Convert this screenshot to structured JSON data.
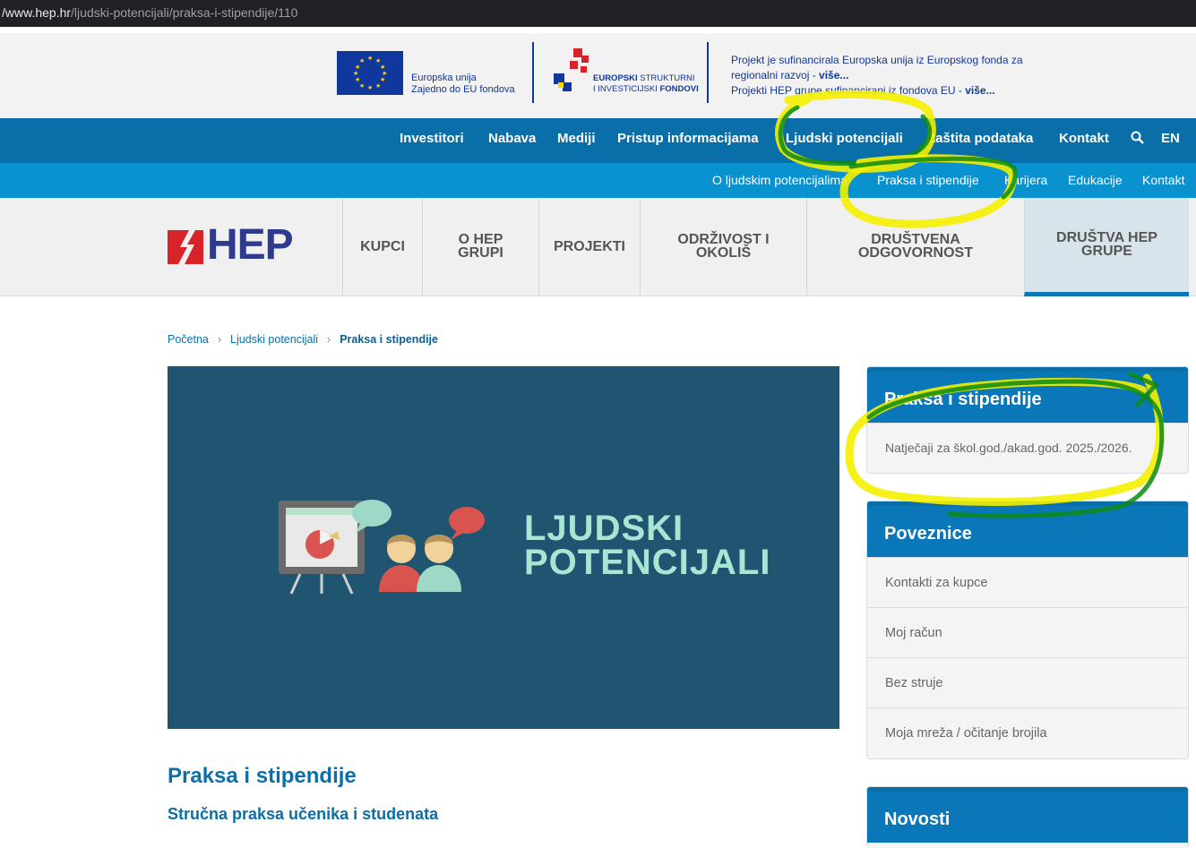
{
  "browser": {
    "url_host": "/www.hep.hr",
    "url_path": "/ljudski-potencijali/praksa-i-stipendije/110"
  },
  "eu_banner": {
    "eu_line1": "Europska unija",
    "eu_line2": "Zajedno do EU fondova",
    "esif_line1_bold": "EUROPSKI",
    "esif_line1_rest": " STRUKTURNI",
    "esif_line2_rest": "I INVESTICIJSKI ",
    "esif_line2_bold": "FONDOVI",
    "note1": "Projekt je sufinancirala Europska unija iz Europskog fonda za",
    "note2": "regionalni razvoj - ",
    "note2_link": "više...",
    "note3": "Projekti HEP grupe sufinancirani iz fondova EU - ",
    "note3_link": "više..."
  },
  "topnav": {
    "items": [
      "Investitori",
      "Nabava",
      "Mediji",
      "Pristup informacijama",
      "Ljudski potencijali",
      "Zaštita podataka",
      "Kontakt"
    ],
    "search_icon": "search-icon",
    "lang": "EN"
  },
  "subnav": {
    "items": [
      "O ljudskim potencijalima",
      "Praksa i stipendije",
      "Karijera",
      "Edukacije",
      "Kontakt"
    ]
  },
  "logo": {
    "text": "HEP"
  },
  "mainnav": {
    "items": [
      {
        "line1": "KUPCI",
        "line2": ""
      },
      {
        "line1": "O HEP",
        "line2": "GRUPI"
      },
      {
        "line1": "PROJEKTI",
        "line2": ""
      },
      {
        "line1": "ODRŽIVOST I",
        "line2": "OKOLIŠ"
      },
      {
        "line1": "DRUŠTVENA",
        "line2": "ODGOVORNOST"
      },
      {
        "line1": "DRUŠTVA HEP",
        "line2": "GRUPE"
      }
    ]
  },
  "breadcrumb": {
    "home": "Početna",
    "section": "Ljudski potencijali",
    "current": "Praksa i stipendije"
  },
  "hero": {
    "line1": "LJUDSKI",
    "line2": "POTENCIJALI"
  },
  "content": {
    "title": "Praksa i stipendije",
    "subtitle": "Stručna praksa učenika i studenata"
  },
  "sidebar": {
    "box1": {
      "title": "Praksa i stipendije",
      "items": [
        "Natječaji za škol.god./akad.god. 2025./2026."
      ]
    },
    "box2": {
      "title": "Poveznice",
      "items": [
        "Kontakti za kupce",
        "Moj račun",
        "Bez struje",
        "Moja mreža / očitanje brojila"
      ]
    },
    "box3": {
      "title": "Novosti"
    }
  },
  "annotations": {
    "yellow": "#f4f000",
    "green": "#0e8a12"
  }
}
